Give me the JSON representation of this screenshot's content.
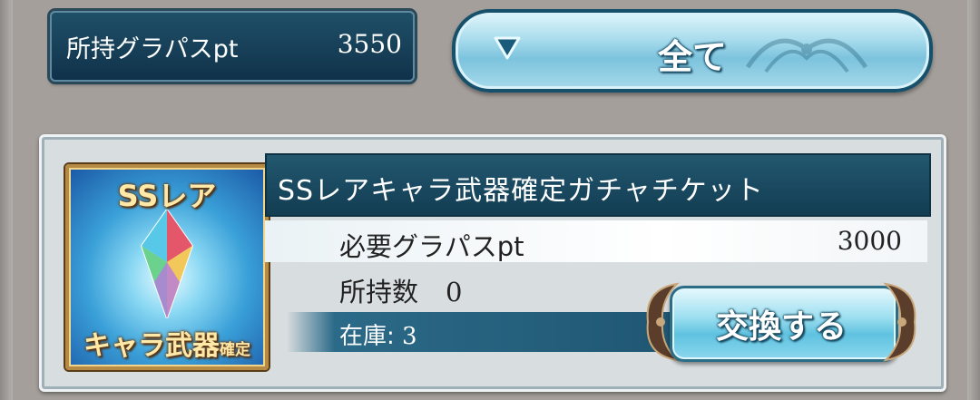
{
  "header": {
    "owned_label": "所持グラパスpt",
    "owned_value": "3550",
    "filter_label": "全て"
  },
  "item": {
    "thumbnail_top_text": "SSレア",
    "thumbnail_bottom_text": "キャラ武器",
    "thumbnail_bottom_small": "確定",
    "name": "SSレアキャラ武器確定ガチャチケット",
    "required_label": "必要グラパスpt",
    "required_value": "3000",
    "owned_count_label": "所持数",
    "owned_count_value": "0",
    "stock_label": "在庫:",
    "stock_value": "3",
    "exchange_label": "交換する"
  },
  "colors": {
    "panel_dark": "#1a4a61",
    "button_light": "#9fe0f1",
    "gold_frame": "#b48a45"
  }
}
